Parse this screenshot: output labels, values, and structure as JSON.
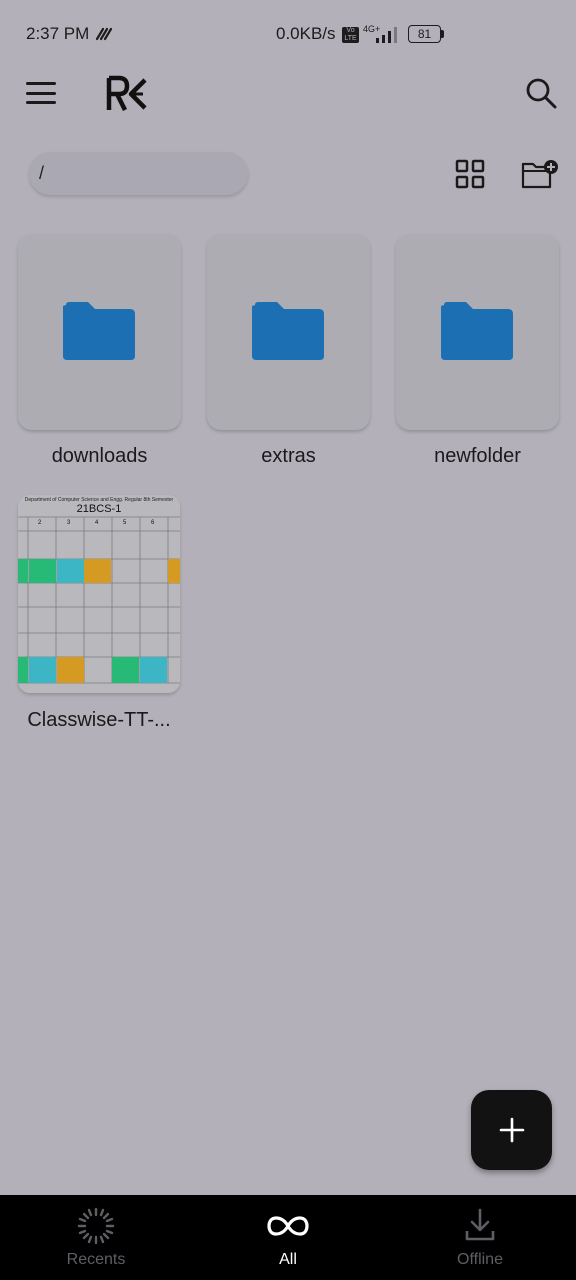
{
  "status_bar": {
    "time": "2:37 PM",
    "network_speed": "0.0KB/s",
    "volte_label": "Vo LTE",
    "network_type": "4G+",
    "battery": "81"
  },
  "app_bar": {
    "logo_text": "R€",
    "icons": [
      "menu-icon",
      "search-icon"
    ]
  },
  "toolbar": {
    "path": "/",
    "icons": [
      "grid-view-icon",
      "new-folder-icon"
    ]
  },
  "folders": [
    {
      "name": "downloads"
    },
    {
      "name": "extras"
    },
    {
      "name": "newfolder"
    }
  ],
  "files": [
    {
      "name": "Classwise-TT-...",
      "preview": {
        "header": "Department of Computer Science and Engg. Regular 8th Semester",
        "class": "21BCS-1",
        "columns": [
          "2",
          "3",
          "4",
          "5",
          "6"
        ]
      }
    }
  ],
  "fab": {
    "icon": "plus-icon"
  },
  "bottom_nav": {
    "items": [
      {
        "label": "Recents",
        "icon": "recents-icon",
        "active": false
      },
      {
        "label": "All",
        "icon": "infinity-icon",
        "active": true
      },
      {
        "label": "Offline",
        "icon": "download-icon",
        "active": false
      }
    ]
  },
  "colors": {
    "background": "#b4b0b9",
    "folder": "#1c6fb3",
    "nav_active": "#ffffff",
    "nav_inactive": "#5e5e64",
    "fab": "#121212"
  }
}
